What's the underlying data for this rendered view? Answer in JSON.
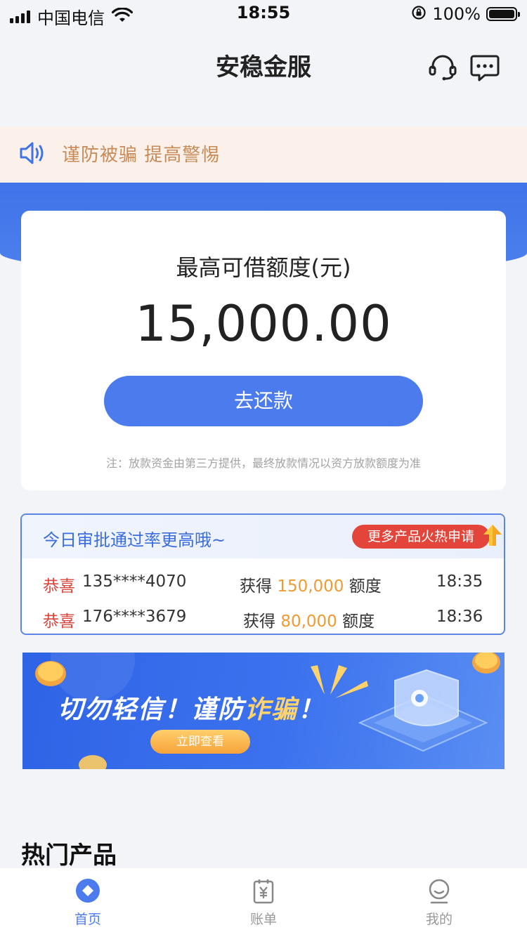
{
  "status_bar": {
    "carrier": "中国电信",
    "time": "18:55",
    "battery": "100%"
  },
  "header": {
    "title": "安稳金服",
    "icons": [
      "headset-icon",
      "message-icon"
    ]
  },
  "notice": {
    "icon": "speaker-icon",
    "text": "谨防被骗 提高警惕"
  },
  "credit": {
    "label": "最高可借额度(元)",
    "amount": "15,000.00",
    "repay_button": "去还款",
    "note": "注：放款资金由第三方提供，最终放款情况以资方放款额度为准"
  },
  "approval": {
    "title": "今日审批通过率更高哦~",
    "hot_button": "更多产品火热申请",
    "rows": [
      {
        "prefix": "恭喜",
        "phone": "135****4070",
        "got": "获得",
        "amount": "150,000",
        "unit": "额度",
        "time": "18:35"
      },
      {
        "prefix": "恭喜",
        "phone": "176****3679",
        "got": "获得",
        "amount": "80,000",
        "unit": "额度",
        "time": "18:36"
      }
    ]
  },
  "banner": {
    "title_part1": "切勿轻信！谨防",
    "title_highlight": "诈骗",
    "title_part2": "！",
    "button": "立即查看"
  },
  "hot_products": {
    "heading": "热门产品"
  },
  "tabbar": {
    "tabs": [
      {
        "label": "首页",
        "icon": "home-icon",
        "active": true
      },
      {
        "label": "账单",
        "icon": "bill-icon",
        "active": false
      },
      {
        "label": "我的",
        "icon": "profile-icon",
        "active": false
      }
    ]
  },
  "colors": {
    "primary": "#4b7bec",
    "notice_bg": "#fcf1ea",
    "notice_text": "#c88b57",
    "highlight_red": "#d9453b",
    "amount_orange": "#f09a33"
  }
}
